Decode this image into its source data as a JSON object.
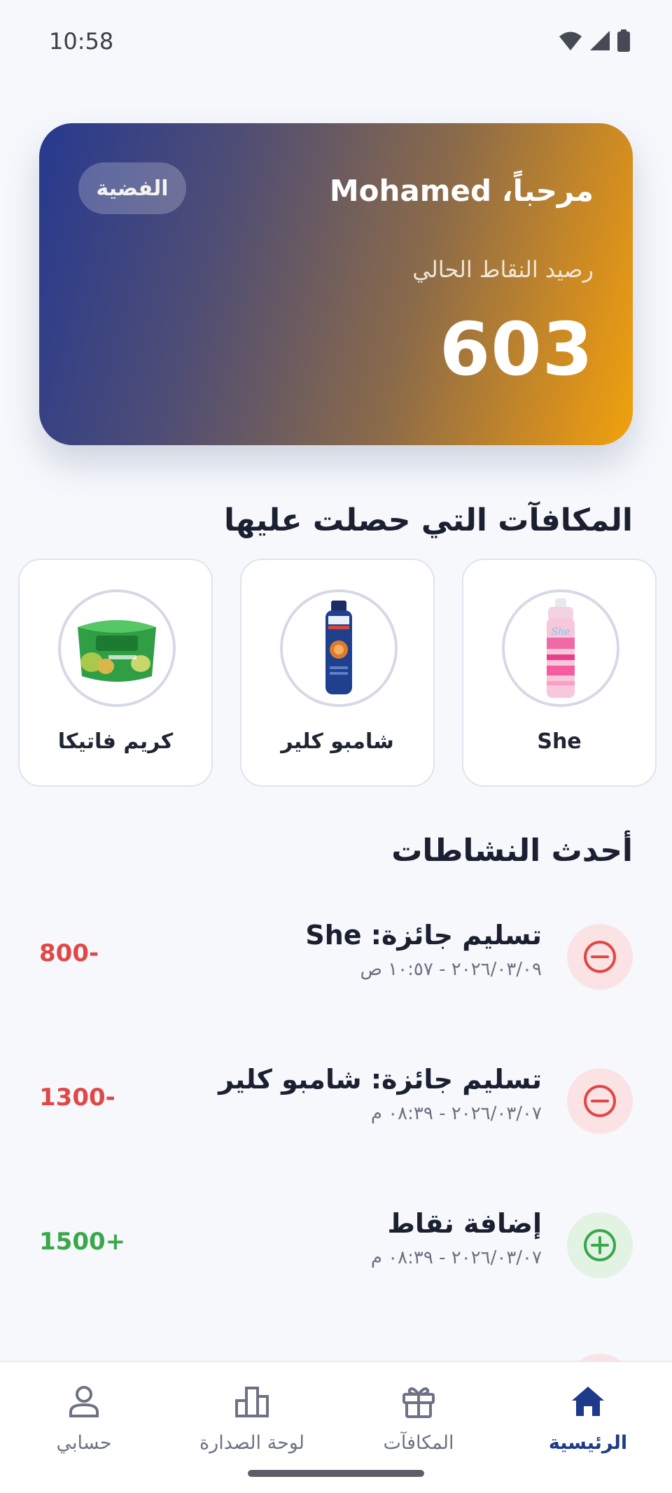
{
  "status": {
    "time": "10:58"
  },
  "card": {
    "greeting": "مرحباً، Mohamed",
    "tier": "الفضية",
    "balance_label": "رصيد النقاط الحالي",
    "balance": "603"
  },
  "rewards": {
    "title": "المكافآت التي حصلت عليها",
    "items": [
      {
        "name": "She",
        "icon": "she-spray-icon"
      },
      {
        "name": "شامبو كلير",
        "icon": "clear-shampoo-icon"
      },
      {
        "name": "كريم فاتيكا",
        "icon": "vatika-cream-icon"
      }
    ]
  },
  "activity": {
    "title": "أحدث النشاطات",
    "items": [
      {
        "title": "تسليم جائزة: She",
        "date": "٢٠٢٦/٠٣/٠٩ - ١٠:٥٧ ص",
        "points": "800-",
        "type": "negative"
      },
      {
        "title": "تسليم جائزة: شامبو كلير",
        "date": "٢٠٢٦/٠٣/٠٧ - ٠٨:٣٩ م",
        "points": "1300-",
        "type": "negative"
      },
      {
        "title": "إضافة نقاط",
        "date": "٢٠٢٦/٠٣/٠٧ - ٠٨:٣٩ م",
        "points": "1500+",
        "type": "positive"
      }
    ]
  },
  "nav": {
    "home": "الرئيسية",
    "rewards": "المكافآت",
    "leaderboard": "لوحة الصدارة",
    "account": "حسابي"
  },
  "colors": {
    "primary": "#1e3a8a",
    "negative": "#e04848",
    "positive": "#3aa84a",
    "card_start": "#27398f",
    "card_end": "#f0a20d"
  }
}
